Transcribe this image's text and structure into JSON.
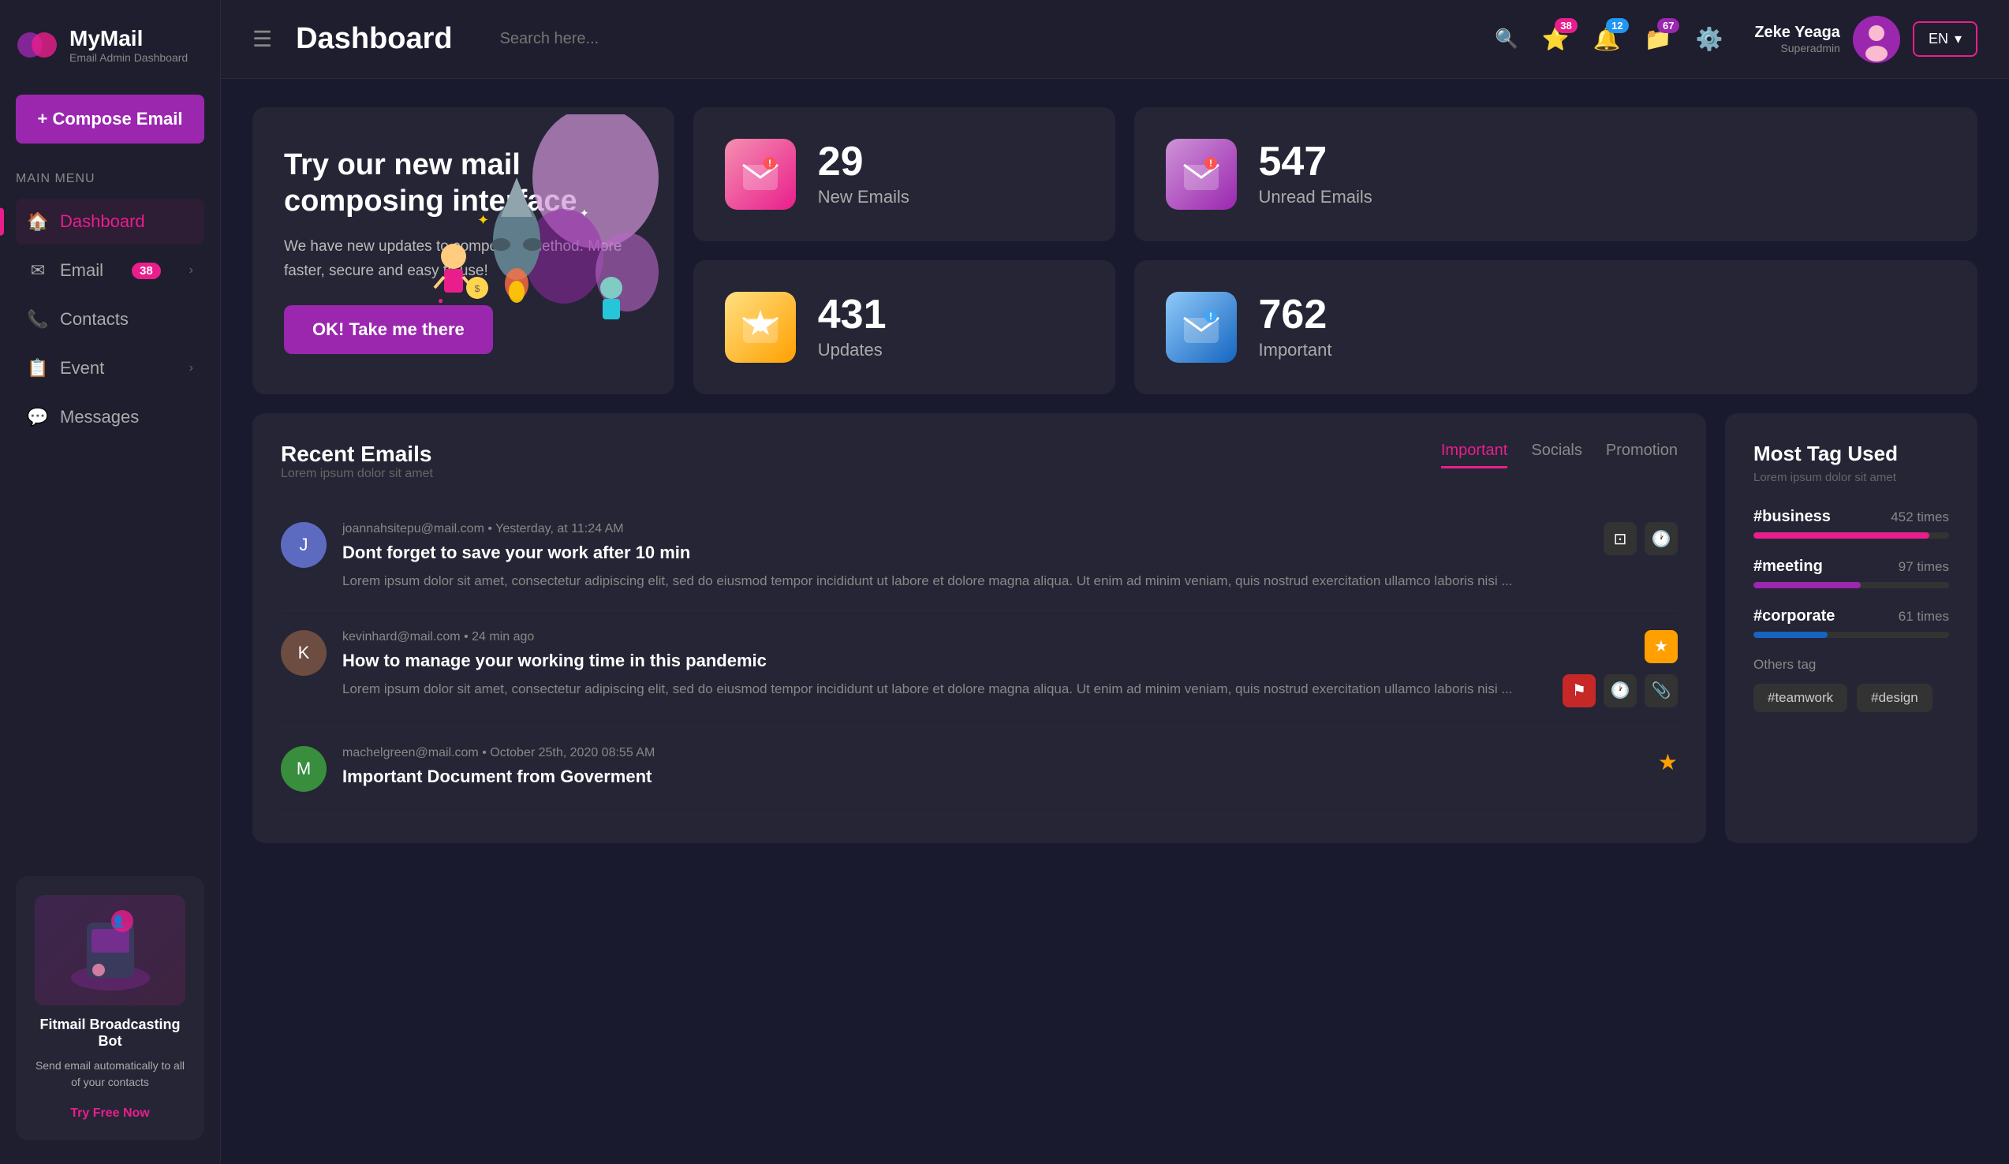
{
  "app": {
    "name": "MyMail",
    "tagline": "Email Admin Dashboard"
  },
  "sidebar": {
    "compose_label": "+ Compose Email",
    "menu_label": "Main Menu",
    "nav_items": [
      {
        "id": "dashboard",
        "label": "Dashboard",
        "icon": "🏠",
        "active": true,
        "badge": null,
        "has_chevron": false
      },
      {
        "id": "email",
        "label": "Email",
        "icon": "✉",
        "active": false,
        "badge": "38",
        "has_chevron": true
      },
      {
        "id": "contacts",
        "label": "Contacts",
        "icon": "📞",
        "active": false,
        "badge": null,
        "has_chevron": false
      },
      {
        "id": "event",
        "label": "Event",
        "icon": "📋",
        "active": false,
        "badge": null,
        "has_chevron": true
      },
      {
        "id": "messages",
        "label": "Messages",
        "icon": "💬",
        "active": false,
        "badge": null,
        "has_chevron": false
      }
    ],
    "promo": {
      "title": "Fitmail Broadcasting Bot",
      "description": "Send email automatically to all of your contacts",
      "cta_label": "Try Free Now"
    }
  },
  "header": {
    "page_title": "Dashboard",
    "search_placeholder": "Search here...",
    "icons": {
      "star_badge": "38",
      "bell_badge": "12",
      "folder_badge": "67"
    },
    "user": {
      "name": "Zeke Yeaga",
      "role": "Superadmin"
    },
    "lang": "EN"
  },
  "stats": [
    {
      "id": "new-emails",
      "value": "29",
      "label": "New Emails",
      "icon": "✉",
      "color": "pink"
    },
    {
      "id": "unread-emails",
      "value": "547",
      "label": "Unread Emails",
      "icon": "✉",
      "color": "purple"
    },
    {
      "id": "updates",
      "value": "431",
      "label": "Updates",
      "icon": "⭐",
      "color": "yellow"
    },
    {
      "id": "important",
      "value": "762",
      "label": "Important",
      "icon": "✉",
      "color": "blue"
    }
  ],
  "promo_banner": {
    "title": "Try our new mail composing interface",
    "description": "We have new updates to composing method. More faster, secure and easy to use!",
    "cta_label": "OK! Take me there"
  },
  "recent_emails": {
    "title": "Recent Emails",
    "subtitle": "Lorem ipsum dolor sit amet",
    "tabs": [
      "Important",
      "Socials",
      "Promotion"
    ],
    "active_tab": "Important",
    "items": [
      {
        "id": 1,
        "from": "joannahsitepu@mail.com",
        "time": "Yesterday, at 11:24 AM",
        "subject": "Dont forget to save your work after 10 min",
        "preview": "Lorem ipsum dolor sit amet, consectetur adipiscing elit, sed do eiusmod tempor incididunt ut labore et dolore magna aliqua. Ut enim ad minim veniam, quis nostrud exercitation ullamco laboris nisi ...",
        "starred": false,
        "actions": [
          "archive",
          "clock"
        ]
      },
      {
        "id": 2,
        "from": "kevinhard@mail.com",
        "time": "24 min ago",
        "subject": "How to manage your working time in this pandemic",
        "preview": "Lorem ipsum dolor sit amet, consectetur adipiscing elit, sed do eiusmod tempor incididunt ut labore et dolore magna aliqua. Ut enim ad minim veniam, quis nostrud exercitation ullamco laboris nisi ...",
        "starred": true,
        "actions": [
          "flag",
          "clock",
          "attach"
        ]
      },
      {
        "id": 3,
        "from": "machelgreen@mail.com",
        "time": "October 25th, 2020  08:55 AM",
        "subject": "Important Document from Goverment",
        "preview": "",
        "starred": true,
        "actions": []
      }
    ]
  },
  "tags": {
    "title": "Most Tag Used",
    "subtitle": "Lorem ipsum dolor sit amet",
    "items": [
      {
        "name": "#business",
        "count": "452 times",
        "percent": 90,
        "color": "pink"
      },
      {
        "name": "#meeting",
        "count": "97 times",
        "percent": 55,
        "color": "purple"
      },
      {
        "name": "#corporate",
        "count": "61 times",
        "percent": 38,
        "color": "blue"
      }
    ],
    "others_label": "Others tag",
    "chips": [
      "#teamwork",
      "#design"
    ]
  }
}
